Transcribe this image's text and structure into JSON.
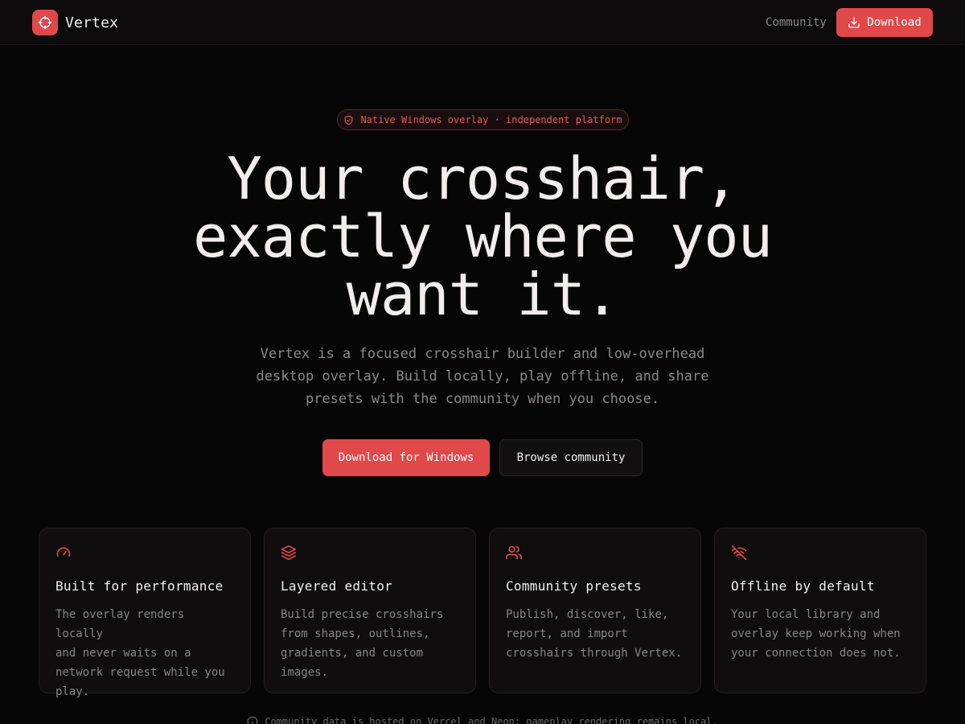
{
  "header": {
    "brand": "Vertex",
    "brand_icon": "crosshair-icon",
    "nav_community": "Community",
    "download_label": "Download",
    "download_icon": "download-icon"
  },
  "hero": {
    "badge_icon": "shield-icon",
    "badge_text": "Native Windows overlay · independent platform",
    "title_lines": [
      "Your crosshair,",
      "exactly where you",
      "want it."
    ],
    "subtitle_lines": [
      "Vertex is a focused crosshair builder and low-overhead",
      "desktop overlay. Build locally, play offline, and share",
      "presets with the community when you choose."
    ],
    "primary_cta": "Download for Windows",
    "secondary_cta": "Browse community"
  },
  "features": [
    {
      "icon": "gauge-icon",
      "title": "Built for performance",
      "desc_lines": [
        "The overlay renders locally",
        "and never waits on a",
        "network request while you",
        "play."
      ]
    },
    {
      "icon": "layers-icon",
      "title": "Layered editor",
      "desc_lines": [
        "Build precise crosshairs",
        "from shapes, outlines,",
        "gradients, and custom",
        "images."
      ]
    },
    {
      "icon": "users-icon",
      "title": "Community presets",
      "desc_lines": [
        "Publish, discover, like,",
        "report, and import",
        "crosshairs through Vertex."
      ]
    },
    {
      "icon": "wifi-off-icon",
      "title": "Offline by default",
      "desc_lines": [
        "Your local library and",
        "overlay keep working when",
        "your connection does not."
      ]
    }
  ],
  "footnote": {
    "icon": "info-icon",
    "text": "Community data is hosted on Vercel and Neon; gameplay rendering remains local."
  },
  "colors": {
    "accent": "#e0484a",
    "background": "#070606",
    "card": "#0f0d0e",
    "muted_text": "#8d8788"
  }
}
